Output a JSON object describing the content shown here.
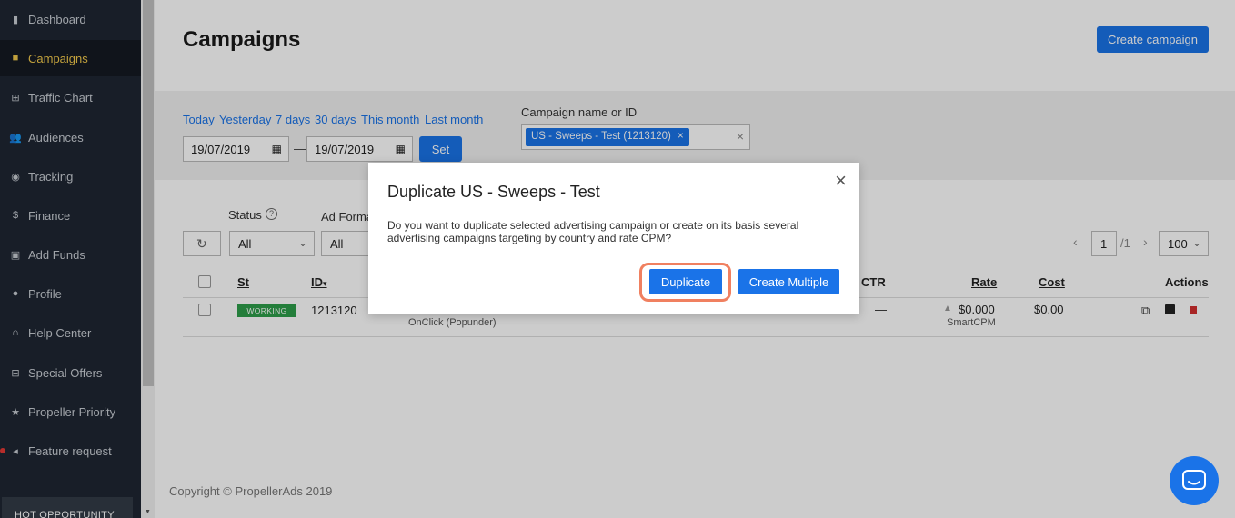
{
  "sidebar": {
    "items": [
      {
        "label": "Dashboard",
        "icon": "bar-chart-icon"
      },
      {
        "label": "Campaigns",
        "icon": "briefcase-icon"
      },
      {
        "label": "Traffic Chart",
        "icon": "plus-square-icon"
      },
      {
        "label": "Audiences",
        "icon": "people-icon"
      },
      {
        "label": "Tracking",
        "icon": "eye-icon"
      },
      {
        "label": "Finance",
        "icon": "dollar-icon"
      },
      {
        "label": "Add Funds",
        "icon": "wallet-icon"
      },
      {
        "label": "Profile",
        "icon": "person-icon"
      },
      {
        "label": "Help Center",
        "icon": "headset-icon"
      },
      {
        "label": "Special Offers",
        "icon": "gift-icon"
      },
      {
        "label": "Propeller Priority",
        "icon": "star-icon"
      },
      {
        "label": "Feature request",
        "icon": "megaphone-icon"
      }
    ],
    "active": "Campaigns",
    "hot_label": "HOT OPPORTUNITY"
  },
  "header": {
    "title": "Campaigns",
    "create_button": "Create campaign"
  },
  "filters": {
    "quick_dates": [
      "Today",
      "Yesterday",
      "7 days",
      "30 days",
      "This month",
      "Last month"
    ],
    "date_from": "19/07/2019",
    "date_to": "19/07/2019",
    "date_separator": "—",
    "set_button": "Set",
    "campaign_label": "Campaign name or ID",
    "campaign_tag": "US - Sweeps - Test (1213120)",
    "tag_remove": "×",
    "clear": "×"
  },
  "table_controls": {
    "status_label": "Status",
    "status_value": "All",
    "ad_format_label": "Ad Format",
    "ad_format_value": "All",
    "page_current": "1",
    "page_total": "/1",
    "per_page": "100"
  },
  "table": {
    "headers": {
      "st": "St",
      "id": "ID",
      "ctr": "CTR",
      "rate": "Rate",
      "cost": "Cost",
      "actions": "Actions"
    },
    "rows": [
      {
        "status": "WORKING",
        "id": "1213120",
        "format": "OnClick (Popunder)",
        "ctr": "—",
        "rate": "$0.000",
        "rate_type": "SmartCPM",
        "cost": "$0.00"
      }
    ]
  },
  "footer": {
    "copyright": "Copyright © PropellerAds 2019"
  },
  "modal": {
    "title": "Duplicate US - Sweeps - Test",
    "text": "Do you want to duplicate selected advertising campaign or create on its basis several advertising campaigns targeting by country and rate CPM?",
    "duplicate_button": "Duplicate",
    "multiple_button": "Create Multiple",
    "close": "×"
  },
  "colors": {
    "accent": "#1a73e8",
    "sidebar": "#1e2632",
    "active": "#f2c94c",
    "status_working": "#2e9e4a",
    "highlight": "#f08060"
  }
}
